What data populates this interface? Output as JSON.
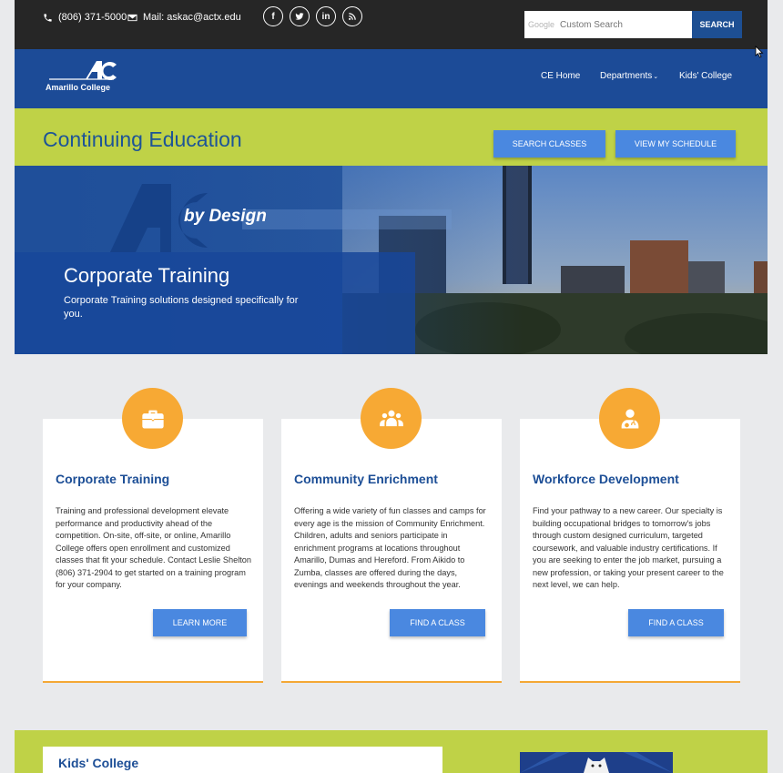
{
  "topbar": {
    "phone": "(806) 371-5000",
    "mail": "Mail: askac@actx.edu",
    "social_icons": [
      "facebook-icon",
      "twitter-icon",
      "linkedin-icon",
      "rss-icon"
    ],
    "search_brand": "Google",
    "search_placeholder": "Custom Search",
    "search_button": "SEARCH"
  },
  "nav": {
    "logo_text": "Amarillo College",
    "items": [
      "CE Home",
      "Departments",
      "Kids' College"
    ]
  },
  "band": {
    "title": "Continuing Education",
    "search_classes": "SEARCH CLASSES",
    "view_schedule": "VIEW MY SCHEDULE"
  },
  "hero": {
    "tagline": "by Design",
    "title": "Corporate Training",
    "subtitle": "Corporate Training solutions designed specifically for you."
  },
  "cards": [
    {
      "icon": "briefcase-icon",
      "title": "Corporate Training",
      "text": "Training and professional development elevate performance and productivity ahead of the competition. On-site, off-site, or online, Amarillo College offers open enrollment and customized classes that fit your schedule. Contact Leslie Shelton (806) 371-2904 to get started on a training program for your company.",
      "button": "LEARN MORE"
    },
    {
      "icon": "group-icon",
      "title": "Community Enrichment",
      "text": "Offering a wide variety of fun classes and camps for every age is the mission of Community Enrichment. Children, adults and seniors participate in enrichment programs at locations throughout Amarillo, Dumas and Hereford. From Aikido to Zumba, classes are offered during the days, evenings and weekends throughout the year.",
      "button": "FIND A CLASS"
    },
    {
      "icon": "doctor-icon",
      "title": "Workforce Development",
      "text": "Find your pathway to a new career. Our specialty is building occupational bridges to tomorrow's jobs through custom designed curriculum, targeted coursework, and valuable industry certifications. If you are seeking to enter the job market, pursuing a new profession, or taking your present career to the next level, we can help.",
      "button": "FIND A CLASS"
    }
  ],
  "bottom": {
    "kids_title": "Kids' College"
  },
  "colors": {
    "nav_blue": "#1c4b97",
    "lime": "#bfd247",
    "button_blue": "#4a88e0",
    "accent_orange": "#f7a934"
  }
}
